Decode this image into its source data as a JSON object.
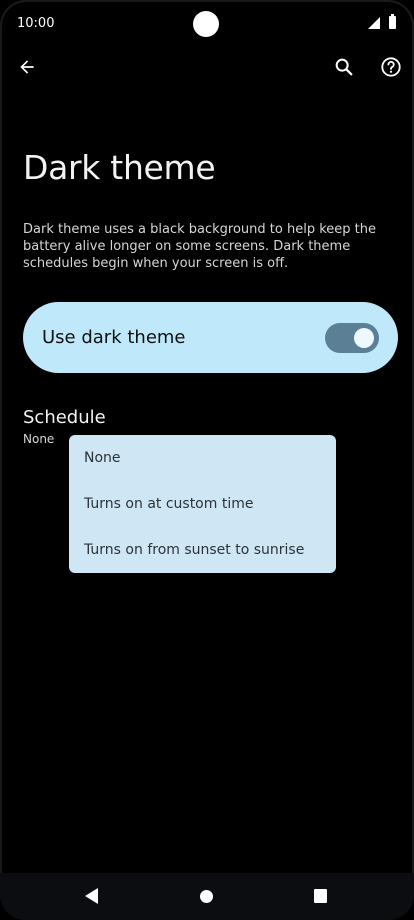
{
  "status_bar": {
    "time": "10:00",
    "icons": [
      "camera-cutout",
      "signal-icon",
      "battery-icon"
    ]
  },
  "app_bar": {
    "back_icon": "arrow-back-icon",
    "search_icon": "search-icon",
    "help_icon": "help-icon"
  },
  "page": {
    "title": "Dark theme",
    "description": "Dark theme uses a black background to help keep the battery alive longer on some screens. Dark theme schedules begin when your screen is off."
  },
  "toggle": {
    "label": "Use dark theme",
    "checked": true,
    "track_color": "#5b7f94",
    "card_color": "#bfe9fb"
  },
  "schedule": {
    "title": "Schedule",
    "value": "None"
  },
  "dropdown": {
    "options": [
      {
        "label": "None"
      },
      {
        "label": "Turns on at custom time"
      },
      {
        "label": "Turns on from sunset to sunrise"
      }
    ],
    "background": "#cfe6f4"
  },
  "nav_bar": {
    "icons": [
      "nav-back-icon",
      "nav-home-icon",
      "nav-recents-icon"
    ]
  }
}
